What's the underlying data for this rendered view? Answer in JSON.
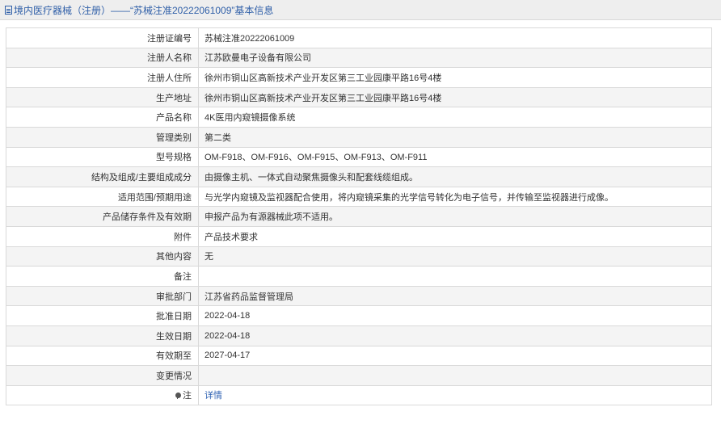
{
  "header": {
    "title": "境内医疗器械（注册）——“苏械注准20222061009”基本信息"
  },
  "rows": [
    {
      "label": "注册证编号",
      "value": "苏械注准20222061009"
    },
    {
      "label": "注册人名称",
      "value": "江苏欧曼电子设备有限公司"
    },
    {
      "label": "注册人住所",
      "value": "徐州市铜山区高新技术产业开发区第三工业园康平路16号4楼"
    },
    {
      "label": "生产地址",
      "value": "徐州市铜山区高新技术产业开发区第三工业园康平路16号4楼"
    },
    {
      "label": "产品名称",
      "value": "4K医用内窥镜摄像系统"
    },
    {
      "label": "管理类别",
      "value": "第二类"
    },
    {
      "label": "型号规格",
      "value": "OM-F918、OM-F916、OM-F915、OM-F913、OM-F911"
    },
    {
      "label": "结构及组成/主要组成成分",
      "value": "由摄像主机、一体式自动聚焦摄像头和配套线缆组成。"
    },
    {
      "label": "适用范围/预期用途",
      "value": "与光学内窥镜及监视器配合使用，将内窥镜采集的光学信号转化为电子信号，并传输至监视器进行成像。"
    },
    {
      "label": "产品储存条件及有效期",
      "value": "申报产品为有源器械此项不适用。"
    },
    {
      "label": "附件",
      "value": "产品技术要求"
    },
    {
      "label": "其他内容",
      "value": "无"
    },
    {
      "label": "备注",
      "value": ""
    },
    {
      "label": "审批部门",
      "value": "江苏省药品监督管理局"
    },
    {
      "label": "批准日期",
      "value": "2022-04-18"
    },
    {
      "label": "生效日期",
      "value": "2022-04-18"
    },
    {
      "label": "有效期至",
      "value": "2027-04-17"
    },
    {
      "label": "变更情况",
      "value": ""
    }
  ],
  "note": {
    "label": "注",
    "icon": "pin-icon",
    "link_text": "详情"
  }
}
